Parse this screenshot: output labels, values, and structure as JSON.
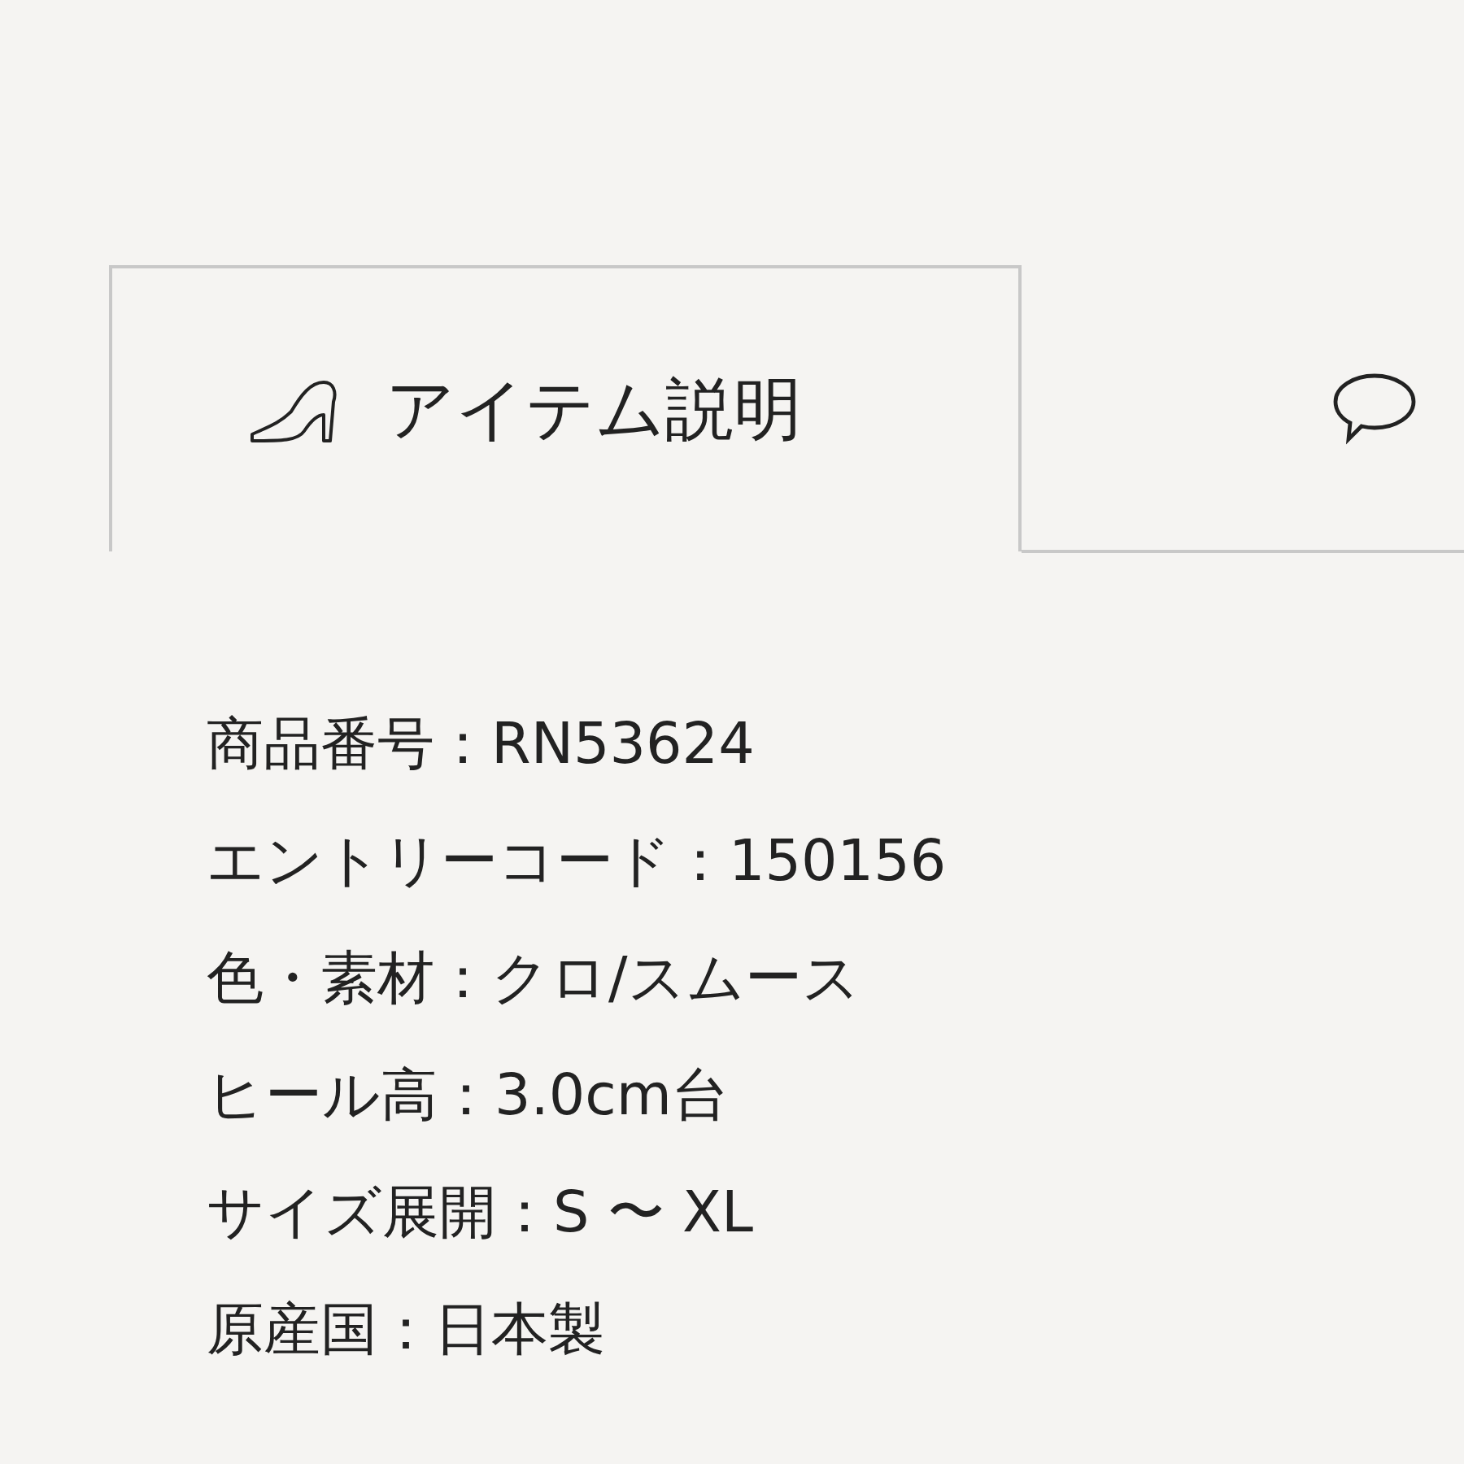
{
  "tabs": [
    {
      "kind": "labeled",
      "label": "アイテム説明",
      "selected": true
    },
    {
      "kind": "comment",
      "selected": false
    }
  ],
  "details": [
    "商品番号：RN53624",
    "エントリーコード：150156",
    "色・素材：クロ/スムース",
    "ヒール高：3.0cm台",
    "サイズ展開：S 〜 XL",
    "原産国：日本製"
  ]
}
